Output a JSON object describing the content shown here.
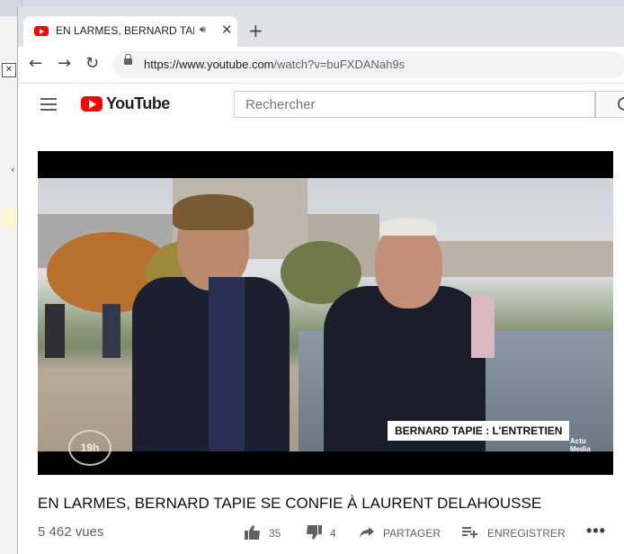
{
  "browser": {
    "tab_title": "EN LARMES, BERNARD TAPIE SE CONFIE À LAURENT DELAHOUSSE",
    "url_host": "https://www.youtube.com",
    "url_path": "/watch?v=buFXDANah9s"
  },
  "youtube": {
    "logo_text": "YouTube",
    "search_placeholder": "Rechercher"
  },
  "video": {
    "overlay_text": "BERNARD TAPIE : L’ENTRETIEN",
    "channel_badge": "19h",
    "corner_logo_line1": "Actu",
    "corner_logo_line2": "Media",
    "title": "EN LARMES, BERNARD TAPIE SE CONFIE À LAURENT DELAHOUSSE",
    "views": "5 462 vues",
    "likes": "35",
    "dislikes": "4",
    "share_label": "PARTAGER",
    "save_label": "ENREGISTRER"
  },
  "colors": {
    "youtube_red": "#ff0000",
    "tabstrip": "#dfe3e8",
    "text_secondary": "#606060"
  }
}
